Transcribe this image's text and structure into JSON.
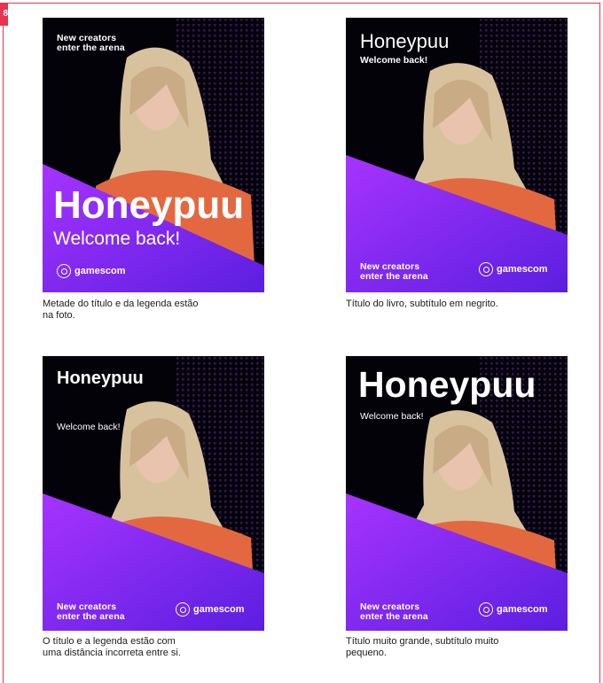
{
  "page_number": "8",
  "brand": {
    "accent_red": "#e8344e",
    "purple_light": "#a733ff",
    "purple_dark": "#5b1fe0",
    "background": "#040209"
  },
  "logo_text": "gamescom",
  "logo_icon": "location-pin-icon",
  "cards": [
    {
      "tagline": "New creators\nenter the arena",
      "title": "Honeypuu",
      "subtitle": "Welcome back!",
      "caption": "Metade do título e da legenda estão\nna foto."
    },
    {
      "tagline": "New creators\nenter the arena",
      "title": "Honeypuu",
      "subtitle": "Welcome back!",
      "caption": "Título do livro, subtítulo em negrito."
    },
    {
      "tagline": "New creators\nenter the arena",
      "title": "Honeypuu",
      "subtitle": "Welcome back!",
      "caption": "O título e a legenda estão com\numa distância incorreta entre si."
    },
    {
      "tagline": "New creators\nenter the arena",
      "title": "Honeypuu",
      "subtitle": "Welcome back!",
      "caption": "Título muito grande, subtítulo muito\npequeno."
    }
  ]
}
